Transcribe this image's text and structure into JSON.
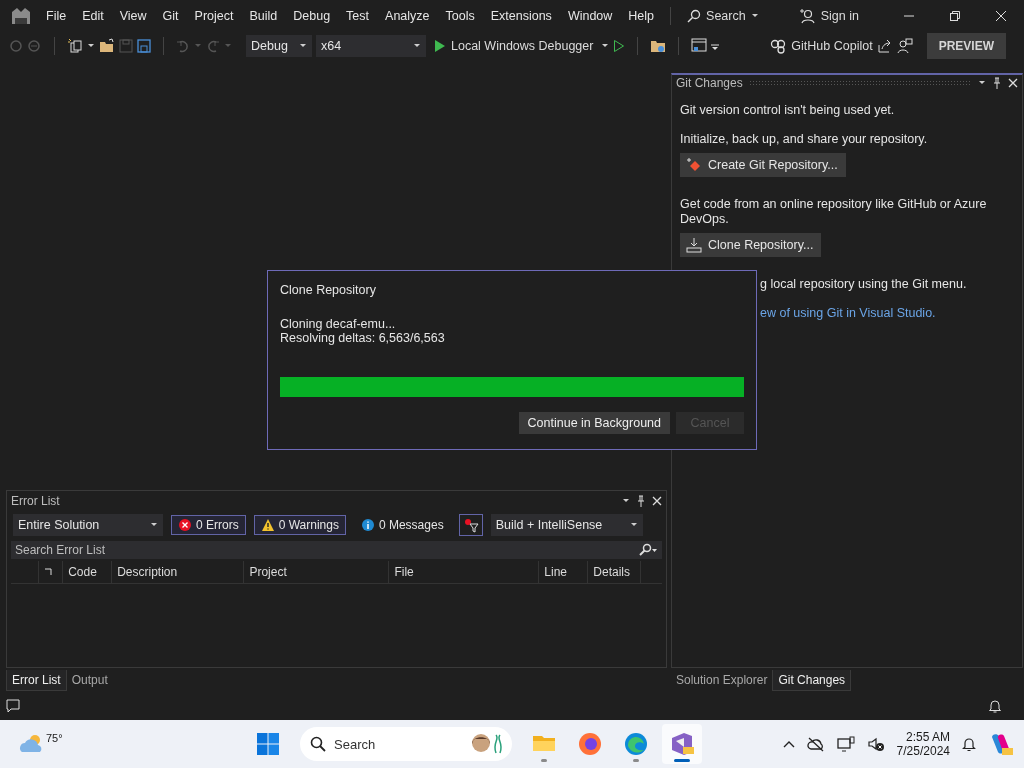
{
  "title_bar": {
    "menu": [
      "File",
      "Edit",
      "View",
      "Git",
      "Project",
      "Build",
      "Debug",
      "Test",
      "Analyze",
      "Tools",
      "Extensions",
      "Window",
      "Help"
    ],
    "search": "Search",
    "sign_in": "Sign in"
  },
  "toolbar": {
    "configuration": "Debug",
    "platform": "x64",
    "run_target": "Local Windows Debugger",
    "copilot": "GitHub Copilot",
    "preview": "PREVIEW"
  },
  "git_changes": {
    "title": "Git Changes",
    "items": [
      {
        "kind": "text",
        "text": "Git version control isn't being used yet."
      },
      {
        "kind": "text",
        "text": "Initialize, back up, and share your repository."
      },
      {
        "kind": "create",
        "text": "Create Git Repository..."
      },
      {
        "kind": "text",
        "text": "Get code from an online repository like GitHub or Azure DevOps."
      },
      {
        "kind": "clone",
        "text": "Clone Repository..."
      },
      {
        "kind": "clipped-text",
        "text": "g local repository using the Git menu."
      },
      {
        "kind": "clipped-link",
        "text": "ew of using Git in Visual Studio."
      }
    ]
  },
  "error_list": {
    "title": "Error List",
    "scope": "Entire Solution",
    "filters": [
      {
        "kind": "error",
        "label": "0 Errors",
        "selected": true
      },
      {
        "kind": "warning",
        "label": "0 Warnings",
        "selected": true
      },
      {
        "kind": "message",
        "label": "0 Messages",
        "selected": false
      }
    ],
    "filter_on": true,
    "source": "Build + IntelliSense",
    "search_placeholder": "Search Error List",
    "columns": [
      "Code",
      "Description",
      "Project",
      "File",
      "Line",
      "Details"
    ]
  },
  "left_tabs": [
    {
      "label": "Error List",
      "selected": true
    },
    {
      "label": "Output",
      "selected": false
    }
  ],
  "right_tabs": [
    {
      "label": "Solution Explorer",
      "selected": false
    },
    {
      "label": "Git Changes",
      "selected": true
    }
  ],
  "dialog": {
    "title": "Clone Repository",
    "lines": [
      "Cloning decaf-emu...",
      "Resolving deltas: 6,563/6,563"
    ],
    "level": 1,
    "buttons": [
      {
        "label": "Continue in Background",
        "disabled": false
      },
      {
        "label": "Cancel",
        "disabled": true
      }
    ]
  },
  "taskbar": {
    "temperature": "75°",
    "search_placeholder": "Search",
    "apps": [
      {
        "kind": "files",
        "running": true,
        "selected": false
      },
      {
        "kind": "firefox",
        "running": false,
        "selected": false
      },
      {
        "kind": "edge",
        "running": true,
        "selected": false
      },
      {
        "kind": "vs",
        "running": true,
        "selected": true
      }
    ],
    "time": "2:55 AM",
    "date": "7/25/2024"
  }
}
